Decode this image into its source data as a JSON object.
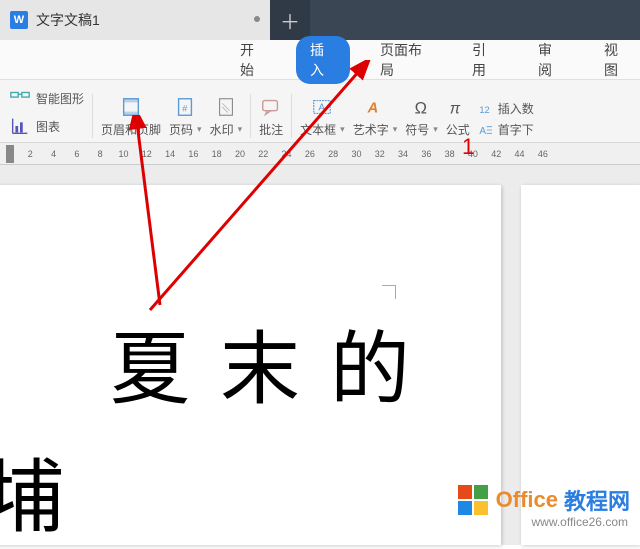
{
  "titlebar": {
    "tab_title": "文字文稿1",
    "newtab": "＋"
  },
  "menu": {
    "start": "开始",
    "insert": "插入",
    "layout": "页面布局",
    "ref": "引用",
    "review": "审阅",
    "view": "视图"
  },
  "toolbar": {
    "smartart": "智能图形",
    "chart": "图表",
    "header_footer": "页眉和页脚",
    "page_number": "页码",
    "watermark": "水印",
    "comment": "批注",
    "textbox": "文本框",
    "wordart": "艺术字",
    "symbol": "符号",
    "equation": "公式",
    "insert_num": "插入数",
    "dropcap": "首字下"
  },
  "ruler": [
    "2",
    "4",
    "6",
    "8",
    "10",
    "12",
    "14",
    "16",
    "18",
    "20",
    "22",
    "24",
    "26",
    "28",
    "30",
    "32",
    "34",
    "36",
    "38",
    "40",
    "42",
    "44",
    "46"
  ],
  "document": {
    "line1": "夏末的",
    "line2_partial": "埔"
  },
  "annotation": {
    "marker1": "1"
  },
  "watermark_logo": {
    "brand1": "Office",
    "brand2": "教程网",
    "url": "www.office26.com"
  }
}
